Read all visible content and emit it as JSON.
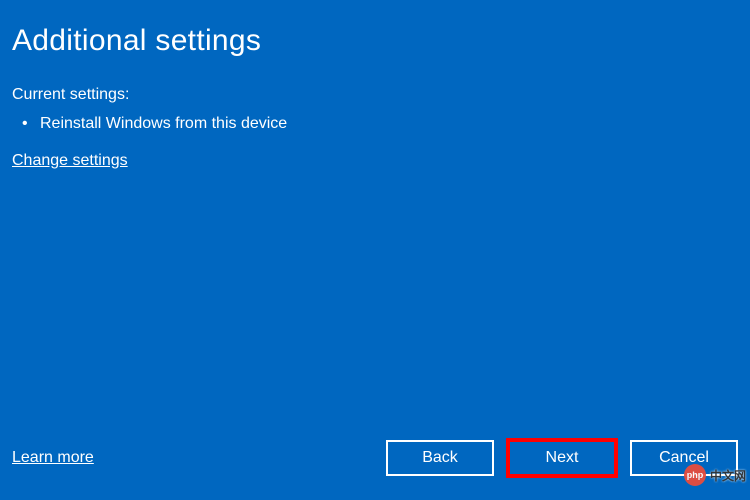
{
  "dialog": {
    "title": "Additional settings",
    "current_settings_label": "Current settings:",
    "bullets": [
      "Reinstall Windows from this device"
    ],
    "change_settings": "Change settings",
    "learn_more": "Learn more",
    "buttons": {
      "back": "Back",
      "next": "Next",
      "cancel": "Cancel"
    }
  },
  "watermark": {
    "logo_text": "php",
    "text": "中文网"
  }
}
